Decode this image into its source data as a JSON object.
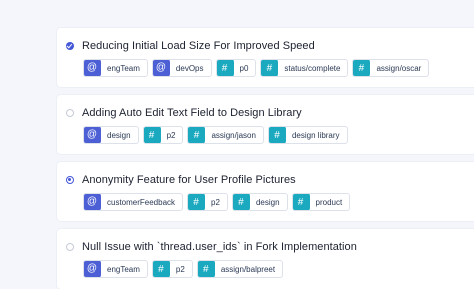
{
  "tasks": [
    {
      "title": "Reducing Initial Load Size For Improved Speed",
      "status": "checked",
      "tags": [
        {
          "kind": "person",
          "icon": "at-icon",
          "glyph": "@",
          "label": "engTeam"
        },
        {
          "kind": "person",
          "icon": "at-icon",
          "glyph": "@",
          "label": "devOps"
        },
        {
          "kind": "hash",
          "icon": "hash-icon",
          "glyph": "#",
          "label": "p0"
        },
        {
          "kind": "hash",
          "icon": "hash-icon",
          "glyph": "#",
          "label": "status/complete"
        },
        {
          "kind": "hash",
          "icon": "hash-icon",
          "glyph": "#",
          "label": "assign/oscar"
        }
      ]
    },
    {
      "title": "Adding Auto Edit Text Field to Design Library",
      "status": "empty",
      "tags": [
        {
          "kind": "person",
          "icon": "at-icon",
          "glyph": "@",
          "label": "design"
        },
        {
          "kind": "hash",
          "icon": "hash-icon",
          "glyph": "#",
          "label": "p2"
        },
        {
          "kind": "hash",
          "icon": "hash-icon",
          "glyph": "#",
          "label": "assign/jason"
        },
        {
          "kind": "hash",
          "icon": "hash-icon",
          "glyph": "#",
          "label": "design library"
        }
      ]
    },
    {
      "title": "Anonymity Feature for User Profile Pictures",
      "status": "dot",
      "tags": [
        {
          "kind": "person",
          "icon": "at-icon",
          "glyph": "@",
          "label": "customerFeedback"
        },
        {
          "kind": "hash",
          "icon": "hash-icon",
          "glyph": "#",
          "label": "p2"
        },
        {
          "kind": "hash",
          "icon": "hash-icon",
          "glyph": "#",
          "label": "design"
        },
        {
          "kind": "hash",
          "icon": "hash-icon",
          "glyph": "#",
          "label": "product"
        }
      ]
    },
    {
      "title": "Null Issue with `thread.user_ids` in Fork Implementation",
      "status": "empty",
      "tags": [
        {
          "kind": "person",
          "icon": "at-icon",
          "glyph": "@",
          "label": "engTeam"
        },
        {
          "kind": "hash",
          "icon": "hash-icon",
          "glyph": "#",
          "label": "p2"
        },
        {
          "kind": "hash",
          "icon": "hash-icon",
          "glyph": "#",
          "label": "assign/balpreet"
        }
      ]
    }
  ],
  "colors": {
    "background": "#f4f6fb",
    "card": "#ffffff",
    "accent": "#4457d6",
    "person_tag": "#4c5fd5",
    "hash_tag": "#1aa9bf",
    "title_text": "#1c2130",
    "tag_text": "#2b3a55"
  }
}
